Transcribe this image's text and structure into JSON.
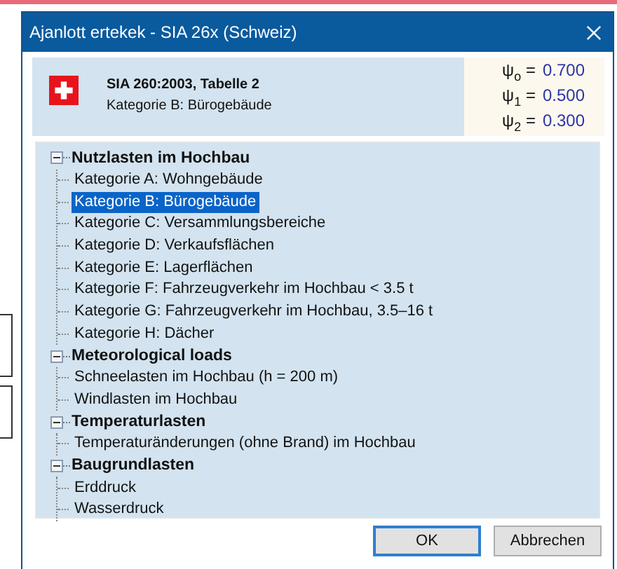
{
  "window": {
    "title": "Ajanlott ertekek - SIA 26x (Schweiz)"
  },
  "header": {
    "title": "SIA 260:2003, Tabelle 2",
    "subtitle": "Kategorie B: Bürogebäude",
    "factors": [
      {
        "symbol": "ψ$_{o}$ =",
        "value": "0.700"
      },
      {
        "symbol": "ψ$_{1}$ =",
        "value": "0.500"
      },
      {
        "symbol": "ψ$_{2}$ =",
        "value": "0.300"
      }
    ]
  },
  "tree": [
    {
      "label": "Nutzlasten im Hochbau",
      "expanded": true,
      "children": [
        {
          "label": "Kategorie A: Wohngebäude",
          "selected": false
        },
        {
          "label": "Kategorie B: Bürogebäude",
          "selected": true
        },
        {
          "label": "Kategorie C: Versammlungsbereiche",
          "selected": false
        },
        {
          "label": "Kategorie D: Verkaufsflächen",
          "selected": false
        },
        {
          "label": "Kategorie E: Lagerflächen",
          "selected": false
        },
        {
          "label": "Kategorie F: Fahrzeugverkehr im Hochbau < 3.5 t",
          "selected": false
        },
        {
          "label": "Kategorie G: Fahrzeugverkehr im Hochbau, 3.5–16 t",
          "selected": false
        },
        {
          "label": "Kategorie H: Dächer",
          "selected": false
        }
      ]
    },
    {
      "label": "Meteorological loads",
      "expanded": true,
      "children": [
        {
          "label": "Schneelasten im Hochbau (h = 200 m)",
          "selected": false
        },
        {
          "label": "Windlasten im Hochbau",
          "selected": false
        }
      ]
    },
    {
      "label": "Temperaturlasten",
      "expanded": true,
      "children": [
        {
          "label": "Temperaturänderungen (ohne Brand) im Hochbau",
          "selected": false
        }
      ]
    },
    {
      "label": "Baugrundlasten",
      "expanded": true,
      "children": [
        {
          "label": "Erddruck",
          "selected": false
        },
        {
          "label": "Wasserdruck",
          "selected": false
        }
      ]
    }
  ],
  "buttons": [
    {
      "label": "OK",
      "selected": true
    },
    {
      "label": "Abbrechen",
      "selected": false
    }
  ]
}
